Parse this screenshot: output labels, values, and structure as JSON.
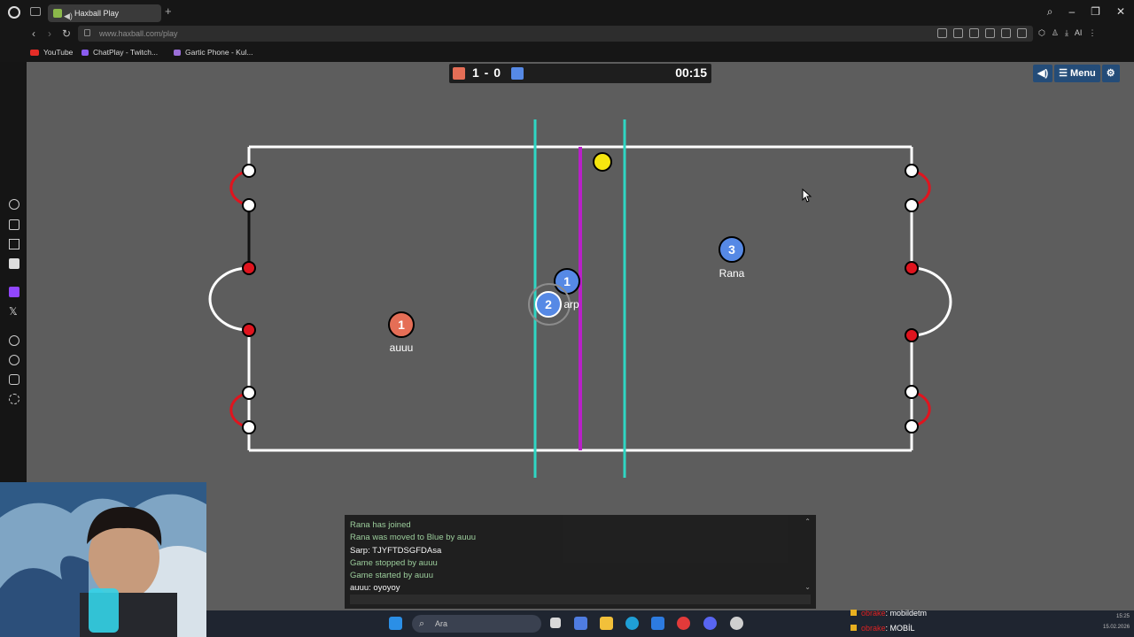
{
  "browser": {
    "tab_title": "Haxball Play",
    "url": "www.haxball.com/play",
    "new_tab": "+",
    "bookmarks": [
      {
        "label": "YouTube",
        "color": "#e52d27"
      },
      {
        "label": "ChatPlay - Twitch...",
        "color": "#8a5cf0"
      },
      {
        "label": "Gartic Phone - Kul...",
        "color": "#9b6fd8"
      }
    ],
    "ai_label": "AI"
  },
  "game": {
    "score": "1 - 0",
    "timer": "00:15",
    "menu_label": "Menu",
    "colors": {
      "red_team": "#e56e56",
      "blue_team": "#5689e5",
      "background": "#5d5d5d"
    },
    "players": [
      {
        "team": "red",
        "number": "1",
        "name": "auuu"
      },
      {
        "team": "blue",
        "number": "1",
        "name": ""
      },
      {
        "team": "blue",
        "number": "2",
        "name": "arp"
      },
      {
        "team": "blue",
        "number": "3",
        "name": "Rana"
      }
    ]
  },
  "chat": {
    "messages": [
      {
        "text": "Rana has joined",
        "kind": "system"
      },
      {
        "text": "Rana was moved to Blue by auuu",
        "kind": "system"
      },
      {
        "text": "Sarp: TJYFTDSGFDAsa",
        "kind": "player"
      },
      {
        "text": "Game stopped by auuu",
        "kind": "system"
      },
      {
        "text": "Game started by auuu",
        "kind": "system"
      },
      {
        "text": "auuu: oyoyoy",
        "kind": "player"
      }
    ]
  },
  "taskbar": {
    "search_placeholder": "Ara",
    "notifications": [
      {
        "name": "obrake",
        "message": ": mobildetm"
      },
      {
        "name": "obrake",
        "message": ": MOBİL"
      }
    ],
    "time": "15:25",
    "date": "15.02.2026"
  }
}
